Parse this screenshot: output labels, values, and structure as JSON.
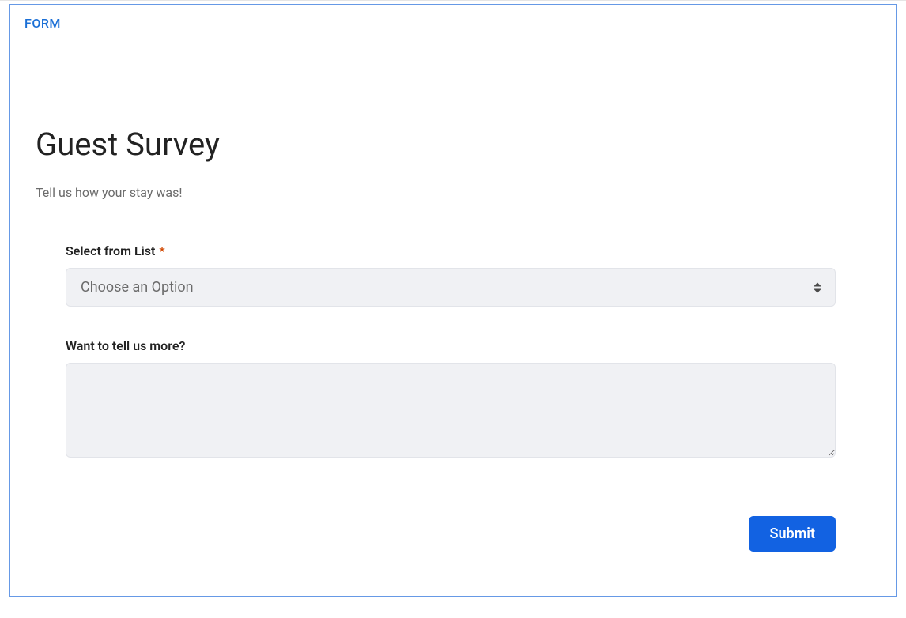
{
  "header": {
    "label": "FORM"
  },
  "form": {
    "title": "Guest Survey",
    "subtitle": "Tell us how your stay was!",
    "fields": {
      "select": {
        "label": "Select from List",
        "required_marker": "*",
        "placeholder": "Choose an Option"
      },
      "textarea": {
        "label": "Want to tell us more?",
        "value": ""
      }
    },
    "submit_label": "Submit"
  }
}
